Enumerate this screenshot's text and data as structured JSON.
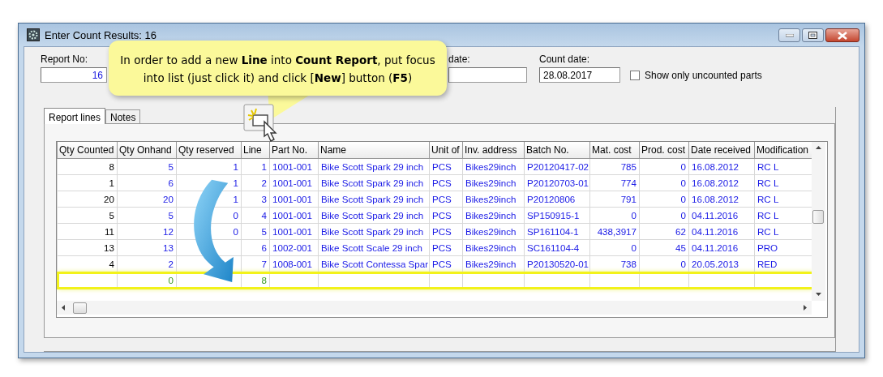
{
  "window": {
    "title": "Enter Count Results: 16"
  },
  "form": {
    "report_no": {
      "label": "Report No:",
      "value": "16"
    },
    "date_field": {
      "label": "date:"
    },
    "count_date": {
      "label": "Count date:",
      "value": "28.08.2017"
    },
    "show_uncounted": {
      "label": "Show only uncounted parts",
      "checked": false
    }
  },
  "callout": {
    "text": "In order to add a new **Line** into **Count Report**, put focus into list (just click it) and click [**New**] button (**F5**)"
  },
  "tabs": [
    {
      "label": "Report lines",
      "selected": true
    },
    {
      "label": "Notes",
      "selected": false
    }
  ],
  "table": {
    "columns": [
      "Qty Counted",
      "Qty Onhand",
      "Qty reserved",
      "Line",
      "Part No.",
      "Name",
      "Unit of",
      "Inv. address",
      "Batch No.",
      "Mat. cost",
      "Prod. cost",
      "Date received",
      "Modification"
    ],
    "rows": [
      {
        "kind": "data",
        "highlighted": false,
        "cells": [
          "8",
          "5",
          "1",
          "1",
          "1001-001",
          "Bike Scott Spark 29 inch",
          "PCS",
          "Bikes29inch",
          "P20120417-02",
          "785",
          "0",
          "16.08.2012",
          "RC L"
        ]
      },
      {
        "kind": "data",
        "highlighted": false,
        "cells": [
          "1",
          "6",
          "1",
          "2",
          "1001-001",
          "Bike Scott Spark 29 inch",
          "PCS",
          "Bikes29inch",
          "P20120703-01",
          "774",
          "0",
          "16.08.2012",
          "RC L"
        ]
      },
      {
        "kind": "data",
        "highlighted": false,
        "cells": [
          "20",
          "20",
          "1",
          "3",
          "1001-001",
          "Bike Scott Spark 29 inch",
          "PCS",
          "Bikes29inch",
          "P20120806",
          "791",
          "0",
          "16.08.2012",
          "RC L"
        ]
      },
      {
        "kind": "data",
        "highlighted": false,
        "cells": [
          "5",
          "5",
          "0",
          "4",
          "1001-001",
          "Bike Scott Spark 29 inch",
          "PCS",
          "Bikes29inch",
          "SP150915-1",
          "0",
          "0",
          "04.11.2016",
          "RC L"
        ]
      },
      {
        "kind": "data",
        "highlighted": false,
        "cells": [
          "11",
          "12",
          "0",
          "5",
          "1001-001",
          "Bike Scott Spark 29 inch",
          "PCS",
          "Bikes29inch",
          "SP161104-1",
          "438,3917",
          "62",
          "04.11.2016",
          "RC L"
        ]
      },
      {
        "kind": "data",
        "highlighted": false,
        "cells": [
          "13",
          "13",
          null,
          "6",
          "1002-001",
          "Bike Scott Scale 29 inch",
          "PCS",
          "Bikes29inch",
          "SC161104-4",
          "0",
          "45",
          "04.11.2016",
          "PRO"
        ]
      },
      {
        "kind": "data",
        "highlighted": false,
        "cells": [
          "4",
          "2",
          null,
          "7",
          "1008-001",
          "Bike Scott Contessa Spar",
          "PCS",
          "Bikes29inch",
          "P20130520-01",
          "738",
          "0",
          "20.05.2013",
          "RED"
        ]
      },
      {
        "kind": "new",
        "highlighted": true,
        "cells": [
          null,
          "0",
          null,
          "8",
          null,
          null,
          null,
          null,
          null,
          null,
          null,
          null,
          null
        ]
      }
    ]
  }
}
